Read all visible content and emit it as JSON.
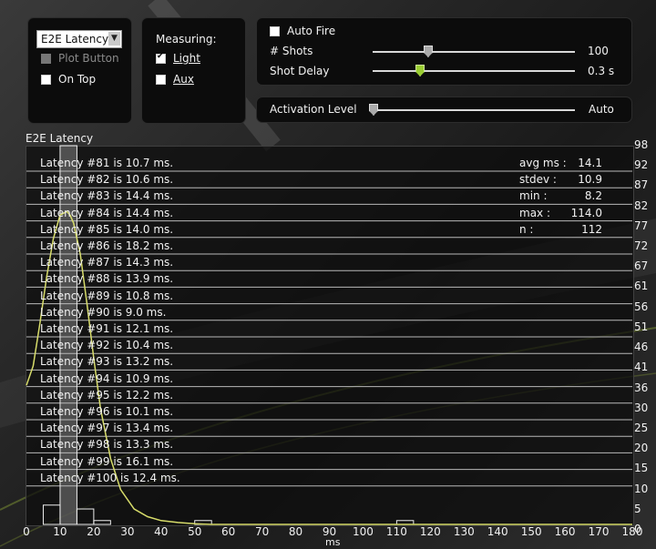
{
  "controls": {
    "mode_dropdown": "E2E Latency",
    "plot_button": "Plot Button",
    "on_top": "On Top",
    "measuring_label": "Measuring:",
    "light": "Light",
    "aux": "Aux",
    "auto_fire": "Auto Fire",
    "shots_label": "# Shots",
    "shots_value": "100",
    "shots_fraction": 0.27,
    "shot_delay_label": "Shot Delay",
    "shot_delay_value": "0.3 s",
    "shot_delay_fraction": 0.23,
    "activation_label": "Activation Level",
    "activation_value": "Auto",
    "activation_fraction": 0.0,
    "light_checked": true,
    "aux_checked": false,
    "on_top_checked": false,
    "auto_fire_checked": false
  },
  "plot": {
    "title": "E2E Latency",
    "latency_lines": [
      "Latency #81  is  10.7  ms.",
      "Latency #82  is  10.6  ms.",
      "Latency #83  is  14.4  ms.",
      "Latency #84  is  14.4  ms.",
      "Latency #85  is  14.0  ms.",
      "Latency #86  is  18.2  ms.",
      "Latency #87  is  14.3  ms.",
      "Latency #88  is  13.9  ms.",
      "Latency #89  is  10.8  ms.",
      "Latency #90  is  9.0  ms.",
      "Latency #91  is  12.1  ms.",
      "Latency #92  is  10.4  ms.",
      "Latency #93  is  13.2  ms.",
      "Latency #94  is  10.9  ms.",
      "Latency #95  is  12.2  ms.",
      "Latency #96  is  10.1  ms.",
      "Latency #97  is  13.4  ms.",
      "Latency #98  is  13.3  ms.",
      "Latency #99  is  16.1  ms.",
      "Latency #100  is  12.4  ms."
    ],
    "stats": [
      {
        "label": "avg ms :",
        "value": "14.1"
      },
      {
        "label": "stdev :",
        "value": "10.9"
      },
      {
        "label": "min :",
        "value": "8.2"
      },
      {
        "label": "max :",
        "value": "114.0"
      },
      {
        "label": "n :",
        "value": "112"
      }
    ]
  },
  "chart_data": {
    "type": "bar",
    "title": "E2E Latency",
    "xlabel": "ms",
    "ylabel": "",
    "xlim": [
      0,
      180
    ],
    "ylim": [
      0,
      98
    ],
    "x_ticks": [
      0,
      10,
      20,
      30,
      40,
      50,
      60,
      70,
      80,
      90,
      100,
      110,
      120,
      130,
      140,
      150,
      160,
      170,
      180
    ],
    "x_tick_labels": [
      "0",
      "10",
      "20",
      "30",
      "40",
      "50",
      "60",
      "70",
      "80",
      "90",
      "100",
      "110",
      "120",
      "130",
      "140",
      "150",
      "160",
      "170",
      "180"
    ],
    "y_tick_labels": [
      "98",
      "92",
      "87",
      "82",
      "77",
      "72",
      "67",
      "61",
      "56",
      "51",
      "46",
      "41",
      "36",
      "30",
      "25",
      "20",
      "15",
      "10",
      "5",
      "0"
    ],
    "bin_width": 5,
    "bins": [
      {
        "x0": 5,
        "x1": 10,
        "count": 5
      },
      {
        "x0": 10,
        "x1": 15,
        "count": 98
      },
      {
        "x0": 15,
        "x1": 20,
        "count": 4
      },
      {
        "x0": 20,
        "x1": 25,
        "count": 1
      },
      {
        "x0": 50,
        "x1": 55,
        "count": 1
      },
      {
        "x0": 110,
        "x1": 115,
        "count": 1
      }
    ],
    "fit_curve": {
      "x": [
        0,
        2,
        4,
        6,
        8,
        10,
        12,
        13,
        14,
        16,
        18,
        20,
        22,
        25,
        28,
        32,
        36,
        40,
        45,
        50,
        55,
        60,
        70,
        80,
        180
      ],
      "y": [
        36,
        41,
        52,
        64,
        74,
        80,
        81,
        80,
        78,
        70,
        57,
        43,
        30,
        17,
        9,
        4,
        2,
        1,
        0.5,
        0.2,
        0,
        0,
        0,
        0,
        0
      ]
    }
  },
  "colors": {
    "curve": "#d7dc6a",
    "bars": "#eeeeee",
    "accent": "#9acd32"
  }
}
